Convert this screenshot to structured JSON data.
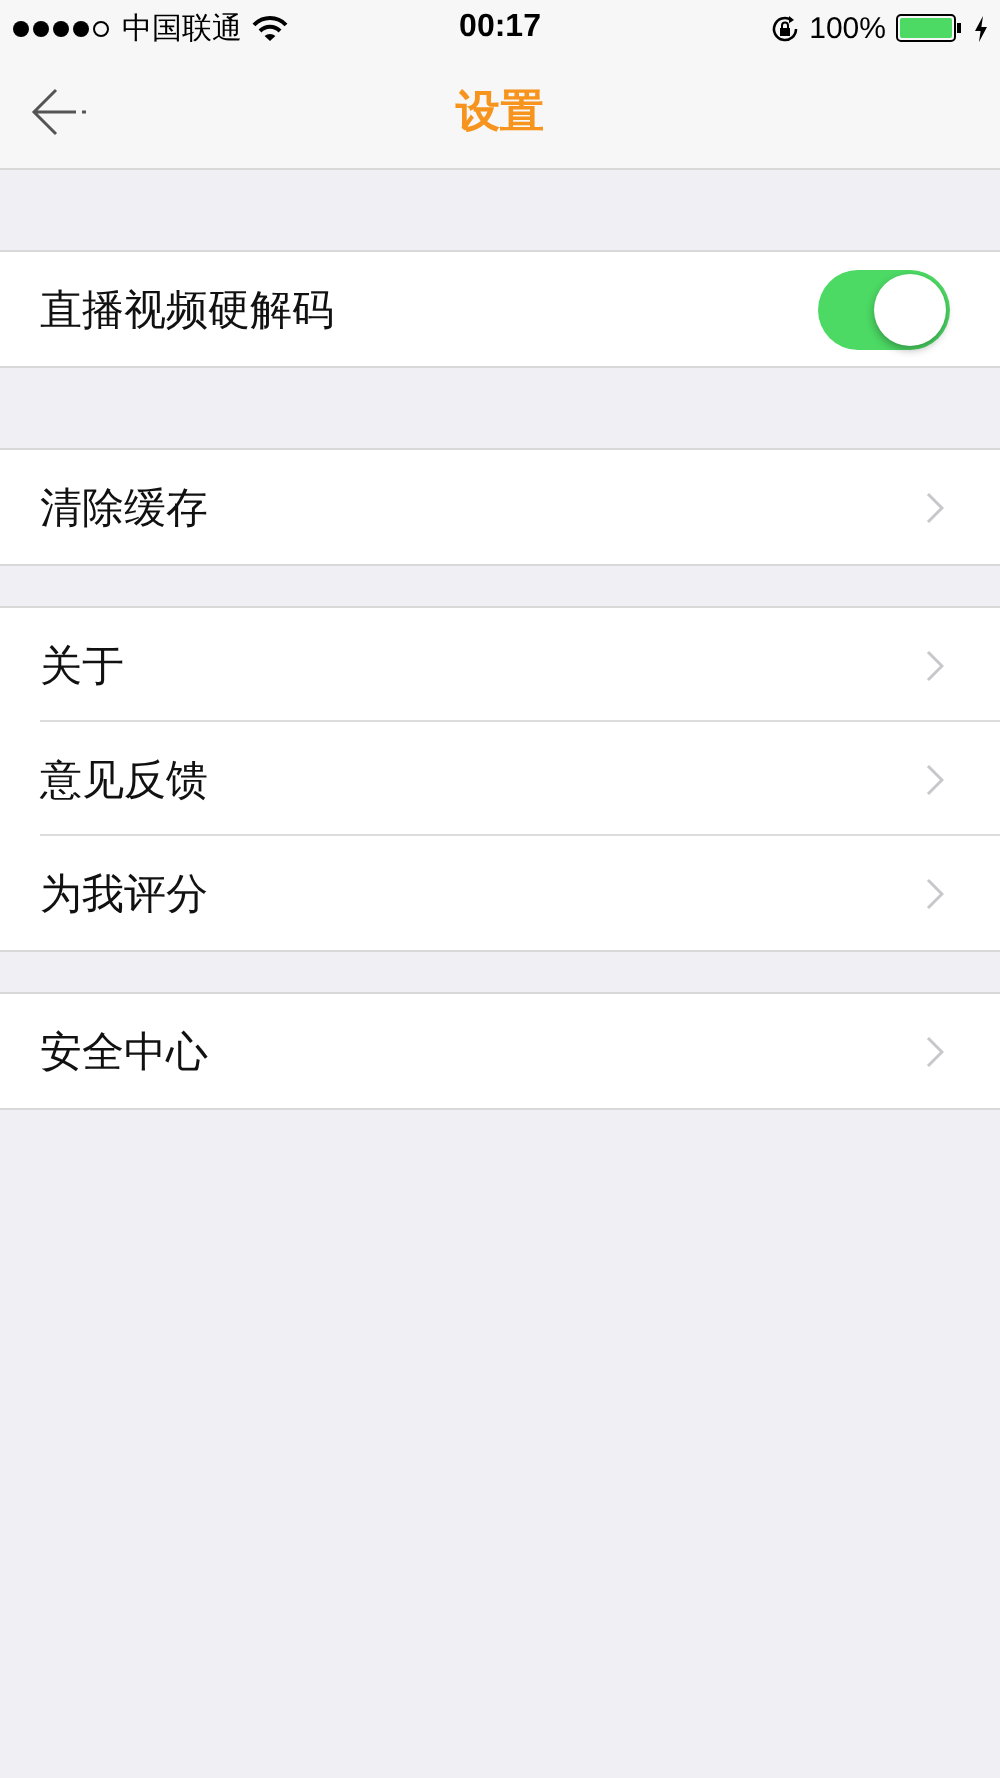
{
  "status_bar": {
    "carrier": "中国联通",
    "time": "00:17",
    "battery": "100%"
  },
  "nav_bar": {
    "title": "设置"
  },
  "sections": [
    {
      "items": [
        {
          "kind": "toggle",
          "label": "直播视频硬解码",
          "on": true
        }
      ]
    },
    {
      "items": [
        {
          "kind": "link",
          "label": "清除缓存"
        }
      ]
    },
    {
      "items": [
        {
          "kind": "link",
          "label": "关于"
        },
        {
          "kind": "link",
          "label": "意见反馈"
        },
        {
          "kind": "link",
          "label": "为我评分"
        }
      ]
    },
    {
      "items": [
        {
          "kind": "link",
          "label": "安全中心"
        }
      ]
    }
  ]
}
